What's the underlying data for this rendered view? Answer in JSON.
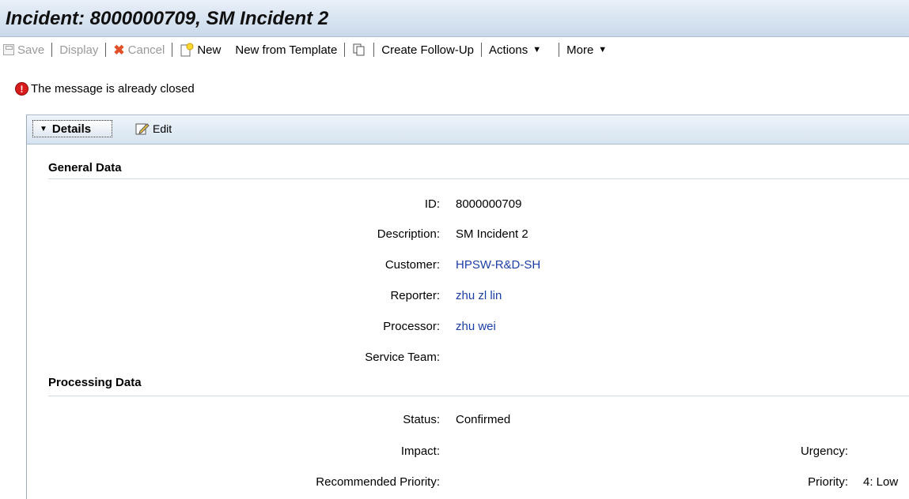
{
  "header": {
    "title": "Incident: 8000000709, SM Incident 2"
  },
  "toolbar": {
    "save": "Save",
    "display": "Display",
    "cancel": "Cancel",
    "new": "New",
    "new_from_template": "New from Template",
    "create_follow_up": "Create Follow-Up",
    "actions": "Actions",
    "more": "More"
  },
  "message": {
    "text": "The message is already closed",
    "icon": "error-icon"
  },
  "panel": {
    "details_label": "Details",
    "edit_label": "Edit"
  },
  "general_data": {
    "heading": "General Data",
    "fields": {
      "id": {
        "label": "ID:",
        "value": "8000000709"
      },
      "description": {
        "label": "Description:",
        "value": "SM Incident 2"
      },
      "customer": {
        "label": "Customer:",
        "value": "HPSW-R&D-SH"
      },
      "reporter": {
        "label": "Reporter:",
        "value": "zhu zl lin"
      },
      "processor": {
        "label": "Processor:",
        "value": "zhu wei"
      },
      "service_team": {
        "label": "Service Team:",
        "value": ""
      }
    }
  },
  "processing_data": {
    "heading": "Processing Data",
    "fields": {
      "status": {
        "label": "Status:",
        "value": "Confirmed"
      },
      "impact": {
        "label": "Impact:",
        "value": ""
      },
      "urgency": {
        "label": "Urgency:",
        "value": ""
      },
      "recommended_priority": {
        "label": "Recommended Priority:",
        "value": ""
      },
      "priority": {
        "label": "Priority:",
        "value": "4: Low"
      }
    }
  },
  "colors": {
    "link": "#1b3fa4",
    "header_bg": "#c9d9ea",
    "error": "#d81c1c"
  }
}
